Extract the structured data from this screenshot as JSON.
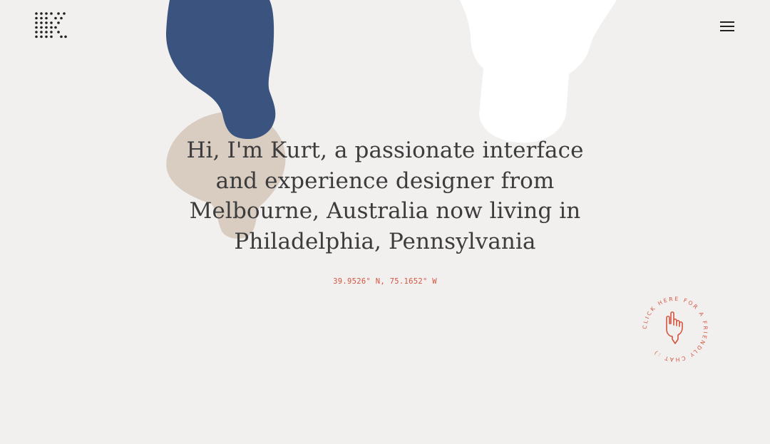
{
  "colors": {
    "background": "#f2f0ef",
    "blob_blue": "#3a547f",
    "blob_beige": "#d9ccc0",
    "blob_white": "#ffffff",
    "text": "#3c3c3c",
    "accent": "#d4553f"
  },
  "header": {
    "logo_icon": "dot-grid-logo-icon",
    "menu_icon": "hamburger-menu-icon"
  },
  "hero": {
    "intro": "Hi, I'm Kurt, a passionate interface and experience designer from Melbourne, Australia now living in Philadelphia, Pennsylvania"
  },
  "location": {
    "coordinates": "39.9526° N, 75.1652° W"
  },
  "chat": {
    "circular_text": "CLICK HERE FOR A FRIENDLY CHAT :)",
    "icon": "pointing-hand-icon"
  }
}
